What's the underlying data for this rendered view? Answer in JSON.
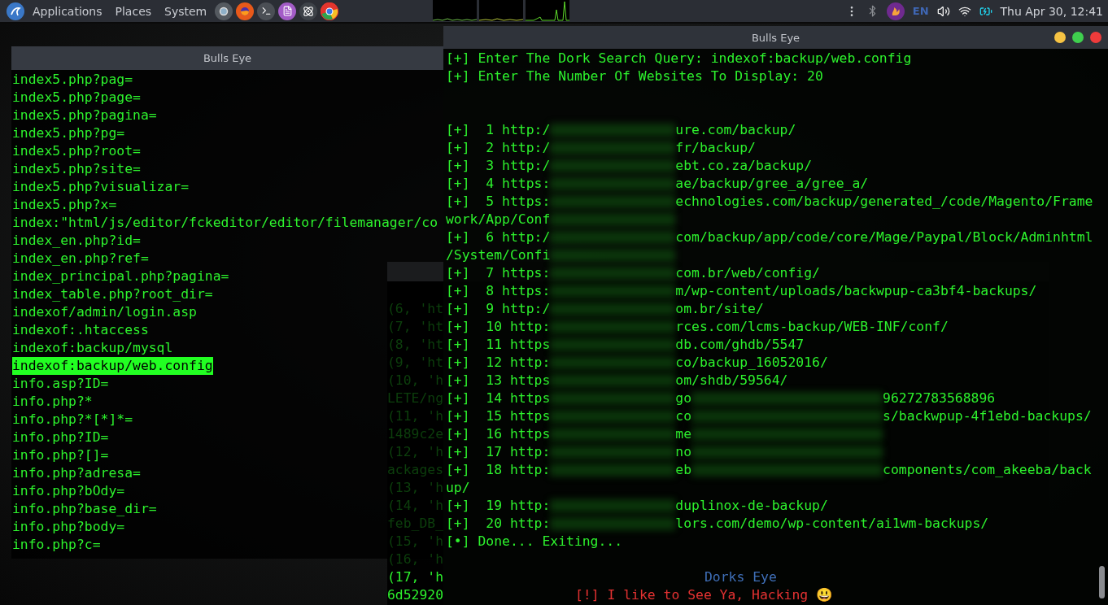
{
  "top_panel": {
    "menus": [
      "Applications",
      "Places",
      "System"
    ],
    "language": "EN",
    "clock": "Thu Apr 30, 12:41"
  },
  "left_terminal": {
    "title": "Bulls Eye",
    "lines": [
      {
        "text": "index5.php?pag=",
        "selected": false
      },
      {
        "text": "index5.php?page=",
        "selected": false
      },
      {
        "text": "index5.php?pagina=",
        "selected": false
      },
      {
        "text": "index5.php?pg=",
        "selected": false
      },
      {
        "text": "index5.php?root=",
        "selected": false
      },
      {
        "text": "index5.php?site=",
        "selected": false
      },
      {
        "text": "index5.php?visualizar=",
        "selected": false
      },
      {
        "text": "index5.php?x=",
        "selected": false
      },
      {
        "text": "index:\"html/js/editor/fckeditor/editor/filemanager/co",
        "selected": false
      },
      {
        "text": "index_en.php?id=",
        "selected": false
      },
      {
        "text": "index_en.php?ref=",
        "selected": false
      },
      {
        "text": "index_principal.php?pagina=",
        "selected": false
      },
      {
        "text": "index_table.php?root_dir=",
        "selected": false
      },
      {
        "text": "indexof/admin/login.asp",
        "selected": false
      },
      {
        "text": "indexof:.htaccess",
        "selected": false
      },
      {
        "text": "indexof:backup/mysql",
        "selected": false
      },
      {
        "text": "indexof:backup/web.config",
        "selected": true
      },
      {
        "text": "info.asp?ID=",
        "selected": false
      },
      {
        "text": "info.php?*",
        "selected": false
      },
      {
        "text": "info.php?*[*]*=",
        "selected": false
      },
      {
        "text": "info.php?ID=",
        "selected": false
      },
      {
        "text": "info.php?[]=",
        "selected": false
      },
      {
        "text": "info.php?adresa=",
        "selected": false
      },
      {
        "text": "info.php?bOdy=",
        "selected": false
      },
      {
        "text": "info.php?base_dir=",
        "selected": false
      },
      {
        "text": "info.php?body=",
        "selected": false
      },
      {
        "text": "info.php?c=",
        "selected": false
      }
    ]
  },
  "middle_terminal": {
    "lines": [
      {
        "text": "(6, 'ht",
        "dim": true
      },
      {
        "text": "(7, 'ht",
        "dim": true
      },
      {
        "text": "(8, 'ht",
        "dim": true
      },
      {
        "text": "(9, 'ht",
        "dim": true
      },
      {
        "text": "(10, 'h",
        "dim": true
      },
      {
        "text": "LETE/ng",
        "dim": true
      },
      {
        "text": "(11, 'h",
        "dim": true
      },
      {
        "text": "1489c2e",
        "dim": true
      },
      {
        "text": "(12, 'h",
        "dim": true
      },
      {
        "text": "ackages",
        "dim": true
      },
      {
        "text": "(13, 'h",
        "dim": true
      },
      {
        "text": "(14, 'h",
        "dim": true
      },
      {
        "text": "feb_DB_",
        "dim": true
      },
      {
        "text": "(15, 'h",
        "dim": true
      },
      {
        "text": "(16, 'h",
        "dim": true
      },
      {
        "text": "(17, 'h",
        "dim": false
      },
      {
        "text": "6d52920",
        "dim": false
      }
    ]
  },
  "right_terminal": {
    "title": "Bulls Eye",
    "prompts": [
      "[+] Enter The Dork Search Query: indexof:backup/web.config",
      "[+] Enter The Number Of Websites To Display: 20"
    ],
    "results": [
      {
        "parts": [
          {
            "kind": "text",
            "text": "[+]  1 http:/"
          },
          {
            "kind": "blur"
          },
          {
            "kind": "text",
            "text": "ure.com/backup/"
          }
        ]
      },
      {
        "parts": [
          {
            "kind": "text",
            "text": "[+]  2 http:/"
          },
          {
            "kind": "blur"
          },
          {
            "kind": "text",
            "text": "fr/backup/"
          }
        ]
      },
      {
        "parts": [
          {
            "kind": "text",
            "text": "[+]  3 http:/"
          },
          {
            "kind": "blur"
          },
          {
            "kind": "text",
            "text": "ebt.co.za/backup/"
          }
        ]
      },
      {
        "parts": [
          {
            "kind": "text",
            "text": "[+]  4 https:"
          },
          {
            "kind": "blur"
          },
          {
            "kind": "text",
            "text": "ae/backup/gree_a/gree_a/"
          }
        ]
      },
      {
        "parts": [
          {
            "kind": "text",
            "text": "[+]  5 https:"
          },
          {
            "kind": "blur"
          },
          {
            "kind": "text",
            "text": "echnologies.com/backup/generated_/code/Magento/Frame"
          }
        ]
      },
      {
        "parts": [
          {
            "kind": "text",
            "text": "work/App/Conf"
          },
          {
            "kind": "blur"
          }
        ]
      },
      {
        "parts": [
          {
            "kind": "text",
            "text": "[+]  6 http:/"
          },
          {
            "kind": "blur"
          },
          {
            "kind": "text",
            "text": "com/backup/app/code/core/Mage/Paypal/Block/Adminhtml"
          }
        ]
      },
      {
        "parts": [
          {
            "kind": "text",
            "text": "/System/Confi"
          },
          {
            "kind": "blur"
          }
        ]
      },
      {
        "parts": [
          {
            "kind": "text",
            "text": "[+]  7 https:"
          },
          {
            "kind": "blur"
          },
          {
            "kind": "text",
            "text": "com.br/web/config/"
          }
        ]
      },
      {
        "parts": [
          {
            "kind": "text",
            "text": "[+]  8 https:"
          },
          {
            "kind": "blur"
          },
          {
            "kind": "text",
            "text": "m/wp-content/uploads/backwpup-ca3bf4-backups/"
          }
        ]
      },
      {
        "parts": [
          {
            "kind": "text",
            "text": "[+]  9 http:/"
          },
          {
            "kind": "blur"
          },
          {
            "kind": "text",
            "text": "om.br/site/"
          }
        ]
      },
      {
        "parts": [
          {
            "kind": "text",
            "text": "[+]  10 http:"
          },
          {
            "kind": "blur"
          },
          {
            "kind": "text",
            "text": "rces.com/lcms-backup/WEB-INF/conf/"
          }
        ]
      },
      {
        "parts": [
          {
            "kind": "text",
            "text": "[+]  11 https"
          },
          {
            "kind": "blur"
          },
          {
            "kind": "text",
            "text": "db.com/ghdb/5547"
          }
        ]
      },
      {
        "parts": [
          {
            "kind": "text",
            "text": "[+]  12 http:"
          },
          {
            "kind": "blur"
          },
          {
            "kind": "text",
            "text": "co/backup_16052016/"
          }
        ]
      },
      {
        "parts": [
          {
            "kind": "text",
            "text": "[+]  13 https"
          },
          {
            "kind": "blur"
          },
          {
            "kind": "text",
            "text": "om/shdb/59564/"
          }
        ]
      },
      {
        "parts": [
          {
            "kind": "text",
            "text": "[+]  14 https"
          },
          {
            "kind": "blur"
          },
          {
            "kind": "text",
            "text": "go"
          },
          {
            "kind": "blur_wide"
          },
          {
            "kind": "text",
            "text": "96272783568896"
          }
        ]
      },
      {
        "parts": [
          {
            "kind": "text",
            "text": "[+]  15 https"
          },
          {
            "kind": "blur"
          },
          {
            "kind": "text",
            "text": "co"
          },
          {
            "kind": "blur_wide"
          },
          {
            "kind": "text",
            "text": "s/backwpup-4f1ebd-backups/"
          }
        ]
      },
      {
        "parts": [
          {
            "kind": "text",
            "text": "[+]  16 https"
          },
          {
            "kind": "blur"
          },
          {
            "kind": "text",
            "text": "me"
          },
          {
            "kind": "blur_wide"
          }
        ]
      },
      {
        "parts": [
          {
            "kind": "text",
            "text": "[+]  17 http:"
          },
          {
            "kind": "blur"
          },
          {
            "kind": "text",
            "text": "no"
          },
          {
            "kind": "blur_wide"
          }
        ]
      },
      {
        "parts": [
          {
            "kind": "text",
            "text": "[+]  18 http:"
          },
          {
            "kind": "blur"
          },
          {
            "kind": "text",
            "text": "eb"
          },
          {
            "kind": "blur_wide"
          },
          {
            "kind": "text",
            "text": "components/com_akeeba/back"
          }
        ]
      },
      {
        "parts": [
          {
            "kind": "text",
            "text": "up/"
          }
        ]
      },
      {
        "parts": [
          {
            "kind": "text",
            "text": "[+]  19 http:"
          },
          {
            "kind": "blur"
          },
          {
            "kind": "text",
            "text": "duplinox-de-backup/"
          }
        ]
      },
      {
        "parts": [
          {
            "kind": "text",
            "text": "[+]  20 http:"
          },
          {
            "kind": "blur"
          },
          {
            "kind": "text",
            "text": "lors.com/demo/wp-content/ai1wm-backups/"
          }
        ]
      }
    ],
    "status": "[•] Done... Exiting...",
    "banner": "Dorks Eye",
    "farewell": "[!] I like to See Ya, Hacking 😃"
  }
}
